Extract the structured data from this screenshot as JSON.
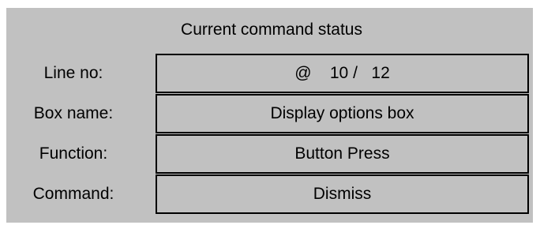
{
  "status_panel": {
    "title": "Current command status",
    "rows": [
      {
        "label": "Line no:",
        "value": "@    10 /   12"
      },
      {
        "label": "Box name:",
        "value": "Display options box"
      },
      {
        "label": "Function:",
        "value": "Button Press"
      },
      {
        "label": "Command:",
        "value": "Dismiss"
      }
    ]
  },
  "colors": {
    "panel_background": "#c1c1c1",
    "border": "#000000",
    "text": "#000000"
  }
}
